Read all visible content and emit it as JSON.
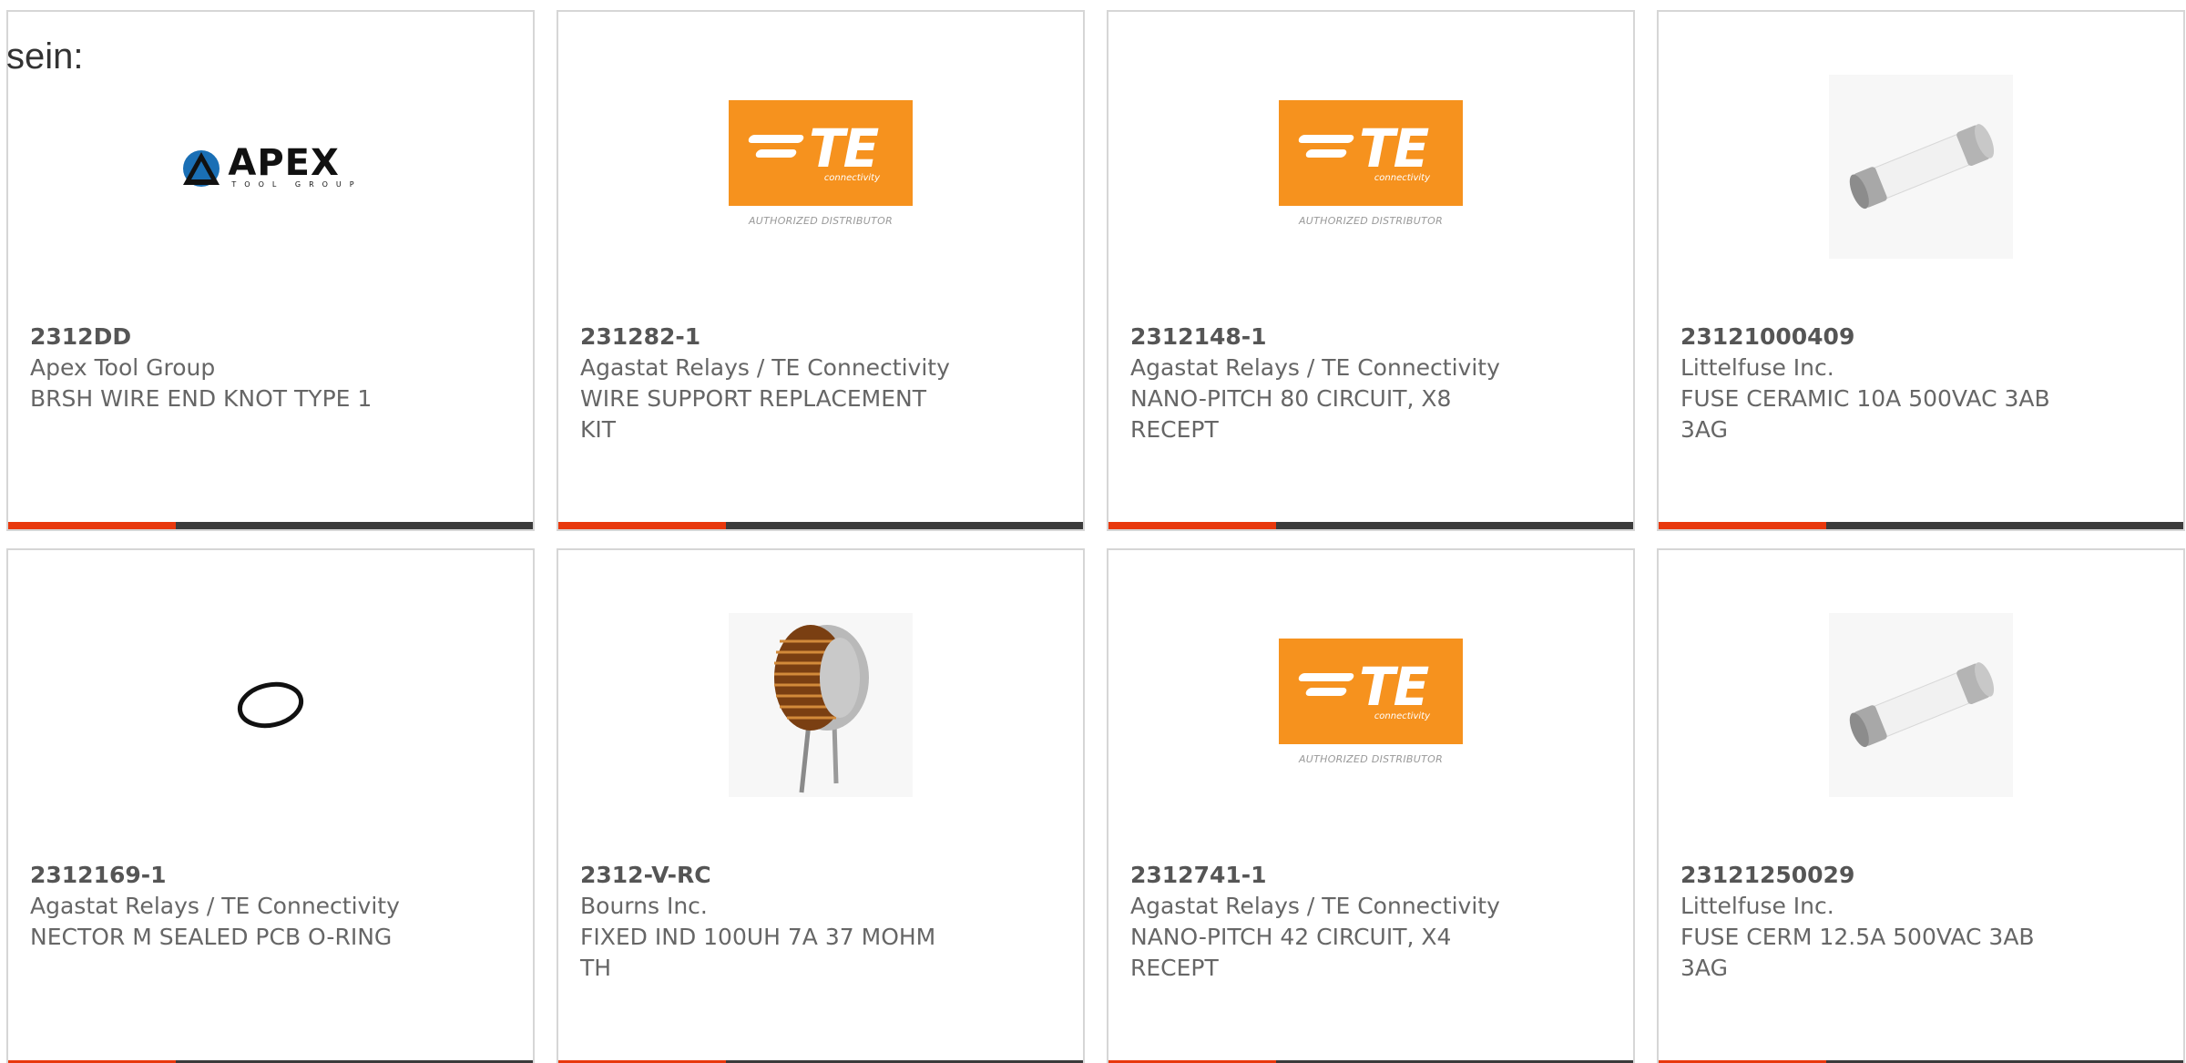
{
  "intro_text": "sein:",
  "colors": {
    "accent": "#e8380d",
    "bar": "#3b3b3b",
    "te_orange": "#f6921e"
  },
  "logos": {
    "apex_word": "APEX",
    "apex_sub": "TOOL GROUP",
    "te_letters": "TE",
    "te_tag": "connectivity",
    "te_authorized": "AUTHORIZED DISTRIBUTOR"
  },
  "products": [
    {
      "part_number": "2312DD",
      "manufacturer": "Apex Tool Group",
      "description": "BRSH WIRE END KNOT TYPE 1",
      "image": "apex-logo"
    },
    {
      "part_number": "231282-1",
      "manufacturer": "Agastat Relays / TE Connectivity",
      "description": "WIRE SUPPORT REPLACEMENT KIT",
      "image": "te-logo"
    },
    {
      "part_number": "2312148-1",
      "manufacturer": "Agastat Relays / TE Connectivity",
      "description": "NANO-PITCH 80 CIRCUIT, X8 RECEPT",
      "image": "te-logo"
    },
    {
      "part_number": "23121000409",
      "manufacturer": "Littelfuse Inc.",
      "description": "FUSE CERAMIC 10A 500VAC 3AB 3AG",
      "image": "fuse-photo"
    },
    {
      "part_number": "2312169-1",
      "manufacturer": "Agastat Relays / TE Connectivity",
      "description": "NECTOR M SEALED PCB O-RING",
      "image": "o-ring-photo"
    },
    {
      "part_number": "2312-V-RC",
      "manufacturer": "Bourns Inc.",
      "description": "FIXED IND 100UH 7A 37 MOHM TH",
      "image": "inductor-photo"
    },
    {
      "part_number": "2312741-1",
      "manufacturer": "Agastat Relays / TE Connectivity",
      "description": "NANO-PITCH 42 CIRCUIT, X4 RECEPT",
      "image": "te-logo"
    },
    {
      "part_number": "23121250029",
      "manufacturer": "Littelfuse Inc.",
      "description": "FUSE CERM 12.5A 500VAC 3AB 3AG",
      "image": "fuse-photo"
    }
  ]
}
